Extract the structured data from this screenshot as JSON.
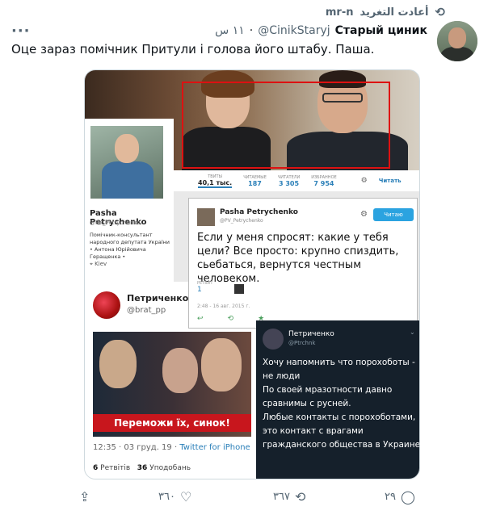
{
  "retweet": {
    "label": "أعادت التغريد",
    "user": "mr-n"
  },
  "header": {
    "name": "Старый циник",
    "handle": "@CinikStaryj",
    "time": "١١ س"
  },
  "tweet": {
    "text": "Оце зараз помічник Притули і голова його штабу. Паша."
  },
  "media": {
    "profile": {
      "name": "Pasha Petrychenko",
      "handle": "@PV_Petrychenko",
      "bio": "Помічник-консультант народного депутата України • Антона Юрійовича Геращенка •",
      "location": "Kiev"
    },
    "stats": [
      {
        "label": "ТВИТЫ",
        "value": "40,1 тыс."
      },
      {
        "label": "ЧИТАЕМЫЕ",
        "value": "187"
      },
      {
        "label": "ЧИТАТЕЛИ",
        "value": "3 305"
      },
      {
        "label": "ИЗБРАННОЕ",
        "value": "7 954"
      }
    ],
    "follow_small": "Читать",
    "quote": {
      "name": "Pasha Petrychenko",
      "handle": "@PV_Petrychenko",
      "follow": "Читаю",
      "text": "Если у меня спросят: какие у тебя цели? Все просто: крупно спиздить, сьебаться, вернутся честным человеком.",
      "rt_label": "РЕТВИТ",
      "rt_count": "1",
      "date": "2:48 - 16 авг. 2015 г."
    },
    "pet": {
      "name": "Петриченко",
      "handle": "@brat_pp",
      "banner": "Переможи їх, синок!",
      "time": "12:35 · 03 груд. 19 ·",
      "source": "Twitter for iPhone",
      "retweets_num": "6",
      "retweets_label": "Ретвітів",
      "likes_num": "36",
      "likes_label": "Уподобань"
    },
    "dark": {
      "name": "Петриченко",
      "handle": "@Ptrchnk",
      "text": "Хочу напомнить что порохоботы - не люди\nПо своей мразотности давно сравнимы с русней.\nЛюбые контакты с порохоботами, это контакт с врагами гражданского общества в Украине"
    }
  },
  "actions": {
    "reply": "٢٩",
    "retweet": "٣٦٧",
    "like": "٣٦٠"
  },
  "icons": [
    "retweet-icon",
    "more-icon",
    "share-icon",
    "like-icon",
    "reply-icon",
    "settings-icon"
  ]
}
